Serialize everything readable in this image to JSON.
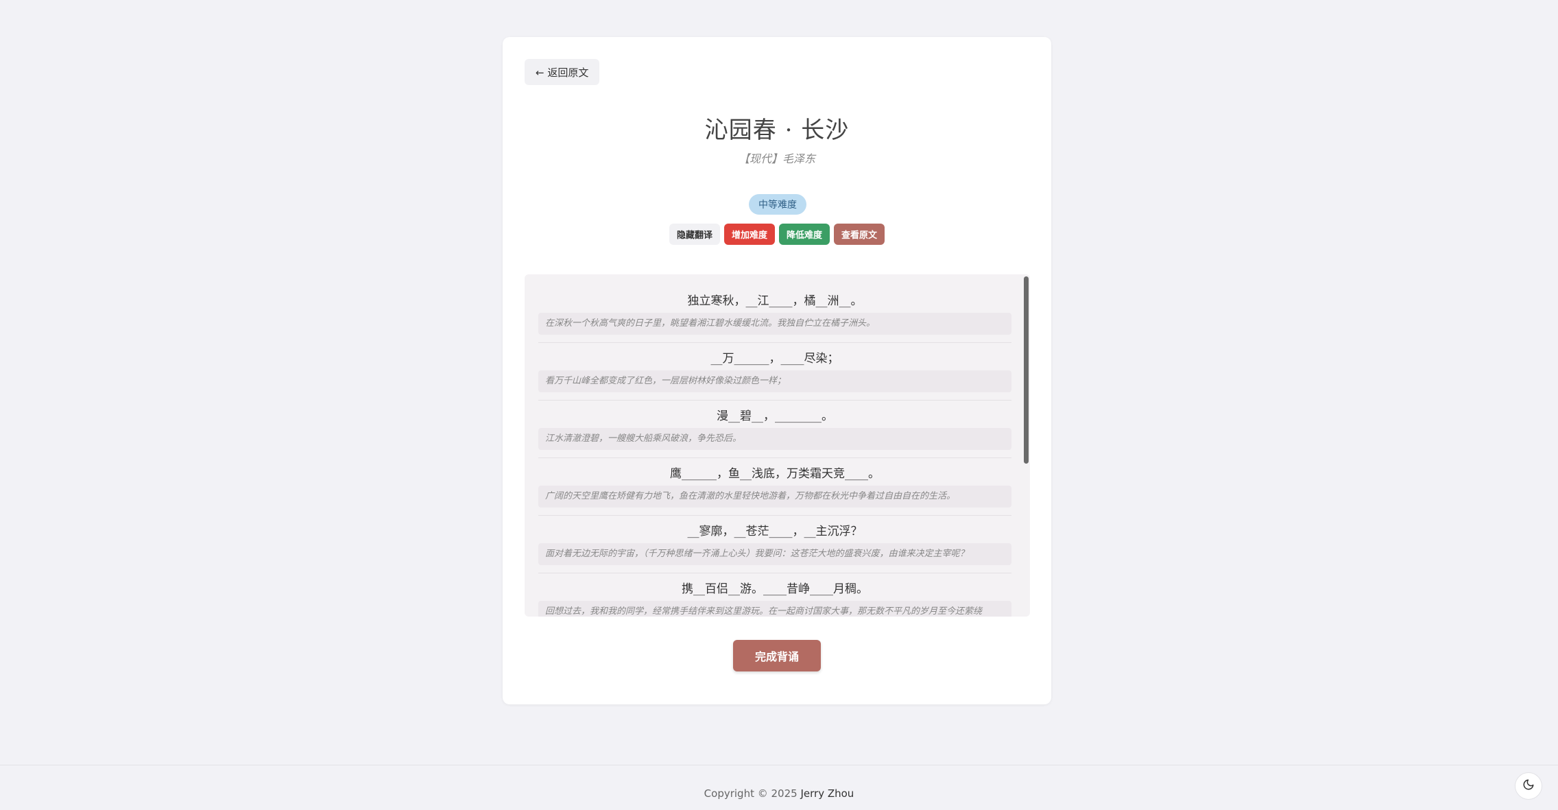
{
  "header": {
    "back_label": "← 返回原文"
  },
  "poem": {
    "title": "沁园春 · 长沙",
    "author": "【现代】毛泽东"
  },
  "difficulty": {
    "badge": "中等难度"
  },
  "controls": {
    "hide_translation": "隐藏翻译",
    "increase": "增加难度",
    "decrease": "降低难度",
    "view_original": "查看原文"
  },
  "lines": [
    {
      "verse": "独立寒秋，__江____，橘__洲__。",
      "translation": "在深秋一个秋高气爽的日子里，眺望着湘江碧水缓缓北流。我独自伫立在橘子洲头。"
    },
    {
      "verse": "__万______，____尽染；",
      "translation": "看万千山峰全都变成了红色，一层层树林好像染过颜色一样；"
    },
    {
      "verse": "漫__碧__，________。",
      "translation": "江水清澈澄碧，一艘艘大船乘风破浪，争先恐后。"
    },
    {
      "verse": "鹰______，鱼__浅底，万类霜天竞____。",
      "translation": "广阔的天空里鹰在矫健有力地飞，鱼在清澈的水里轻快地游着，万物都在秋光中争着过自由自在的生活。"
    },
    {
      "verse": "__寥廓，__苍茫____，__主沉浮？",
      "translation": "面对着无边无际的宇宙，（千万种思绪一齐涌上心头）我要问：这苍茫大地的盛衰兴废，由谁来决定主宰呢？"
    },
    {
      "verse": "携__百侣__游。____昔峥____月稠。",
      "translation": "回想过去，我和我的同学，经常携手结伴来到这里游玩。在一起商讨国家大事，那无数不平凡的岁月至今还萦绕"
    }
  ],
  "actions": {
    "done": "完成背诵"
  },
  "footer": {
    "copyright": "Copyright © 2025",
    "name": "Jerry Zhou"
  },
  "icons": {
    "theme_toggle": "moon-icon"
  },
  "colors": {
    "badge_bg": "#bcdcf2",
    "increase": "#e0423a",
    "decrease": "#3b9e64",
    "view_original": "#b36b62",
    "done": "#b36b62"
  }
}
